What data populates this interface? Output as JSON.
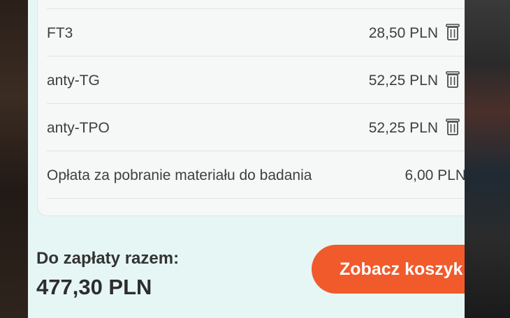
{
  "cart": {
    "items": [
      {
        "name": "FT3",
        "price": "28,50 PLN"
      },
      {
        "name": "anty-TG",
        "price": "52,25 PLN"
      },
      {
        "name": "anty-TPO",
        "price": "52,25 PLN"
      }
    ],
    "fee": {
      "name": "Opłata za pobranie materiału do badania",
      "price": "6,00 PLN"
    }
  },
  "summary": {
    "total_label": "Do zapłaty razem:",
    "total_value": "477,30 PLN",
    "cart_button_label": "Zobacz koszyk"
  },
  "colors": {
    "accent": "#f15a2b",
    "sheet_background": "#e6f6f4",
    "card_background": "#f6f7f7"
  },
  "icons": {
    "delete": "trash-icon"
  }
}
